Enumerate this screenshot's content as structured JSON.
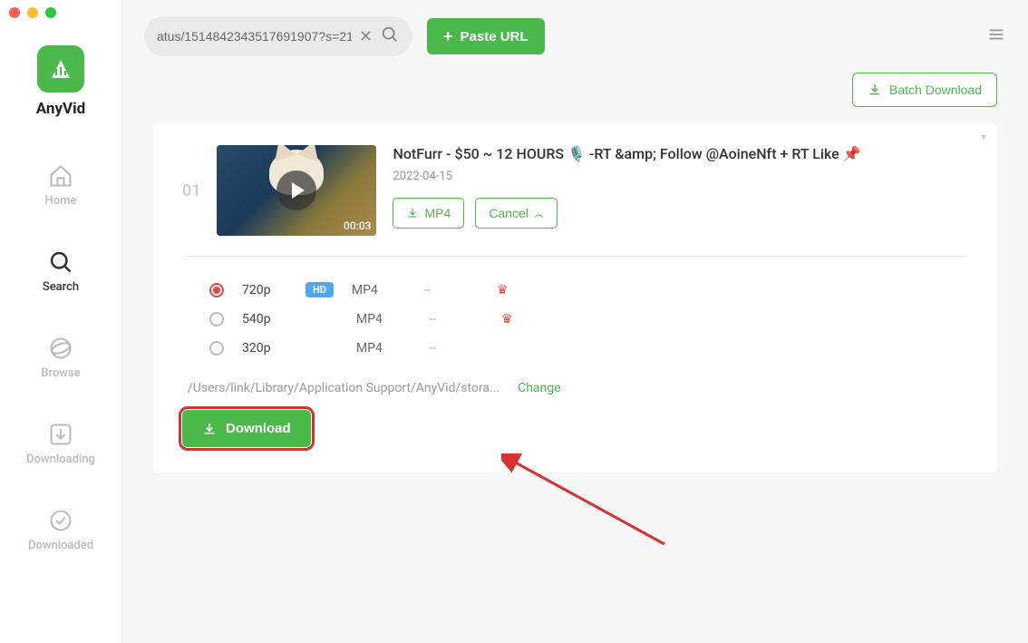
{
  "brand": "AnyVid",
  "nav": {
    "home": "Home",
    "search": "Search",
    "browse": "Browse",
    "downloading": "Downloading",
    "downloaded": "Downloaded"
  },
  "topbar": {
    "search_value": "atus/1514842343517691907?s=21",
    "paste_label": "Paste URL"
  },
  "batch_label": "Batch Download",
  "result": {
    "index": "01",
    "duration": "00:03",
    "title": "NotFurr - $50 ~ 12 HOURS 🎙️ -RT &amp; Follow @AoineNft + RT Like 📌",
    "date": "2022-04-15",
    "mp4_label": "MP4",
    "cancel_label": "Cancel",
    "formats": [
      {
        "res": "720p",
        "hd": "HD",
        "fmt": "MP4",
        "size": "--",
        "premium": true,
        "selected": true
      },
      {
        "res": "540p",
        "hd": "",
        "fmt": "MP4",
        "size": "--",
        "premium": true,
        "selected": false
      },
      {
        "res": "320p",
        "hd": "",
        "fmt": "MP4",
        "size": "--",
        "premium": false,
        "selected": false
      }
    ],
    "save_path": "/Users/link/Library/Application Support/AnyVid/stora...",
    "change_label": "Change",
    "download_label": "Download"
  }
}
